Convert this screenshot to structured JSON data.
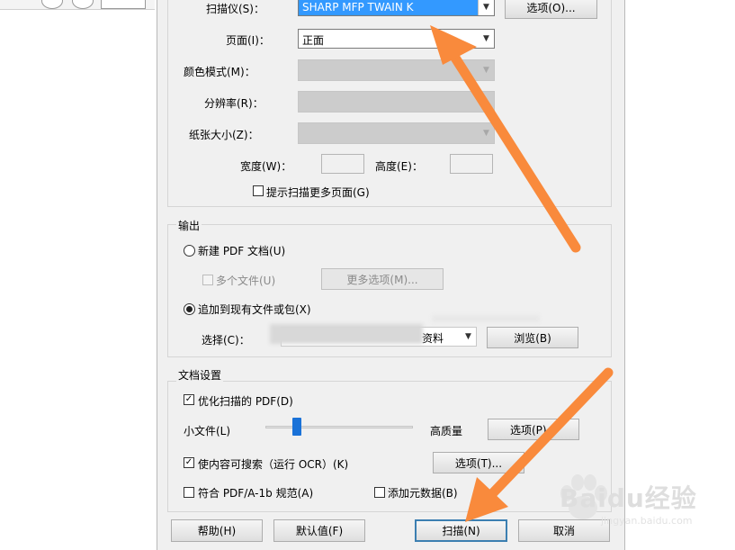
{
  "scanner": {
    "label": "扫描仪(S)：",
    "value": "SHARP MFP TWAIN K",
    "options_button": "选项(O)..."
  },
  "page": {
    "label": "页面(I)：",
    "value": "正面"
  },
  "color_mode": {
    "label": "颜色模式(M)："
  },
  "resolution": {
    "label": "分辨率(R)："
  },
  "paper_size": {
    "label": "纸张大小(Z)："
  },
  "width": {
    "label": "宽度(W)："
  },
  "height": {
    "label": "高度(E)："
  },
  "prompt_more_pages": {
    "label": "提示扫描更多页面(G)",
    "checked": false
  },
  "output": {
    "title": "输出",
    "new_pdf": {
      "label": "新建 PDF 文档(U)",
      "selected": false
    },
    "multiple_files": {
      "label": "多个文件(U)",
      "checked": false
    },
    "more_options_button": "更多选项(M)...",
    "append_existing": {
      "label": "追加到现有文件或包(X)",
      "selected": true
    },
    "select": {
      "label": "选择(C)：",
      "value_suffix": "资料"
    },
    "browse_button": "浏览(B)"
  },
  "doc_settings": {
    "title": "文档设置",
    "optimize_pdf": {
      "label": "优化扫描的 PDF(D)",
      "checked": true
    },
    "small_file_label": "小文件(L)",
    "high_quality_label": "高质量",
    "quality_level": 0.2,
    "options_p_button": "选项(P)...",
    "searchable": {
      "label": "使内容可搜索（运行 OCR）(K)",
      "checked": true
    },
    "options_t_button": "选项(T)...",
    "pdfa": {
      "label": "符合 PDF/A-1b 规范(A)",
      "checked": false
    },
    "metadata": {
      "label": "添加元数据(B)",
      "checked": false
    }
  },
  "buttons": {
    "help": "帮助(H)",
    "defaults": "默认值(F)",
    "scan": "扫描(N)",
    "cancel": "取消"
  },
  "watermark": {
    "text": "Baidu经验",
    "sub": "jingyan.baidu.com"
  },
  "colors": {
    "annotation_arrow": "#f98a3c",
    "selection": "#3399ff",
    "slider_thumb": "#1a72d8"
  }
}
